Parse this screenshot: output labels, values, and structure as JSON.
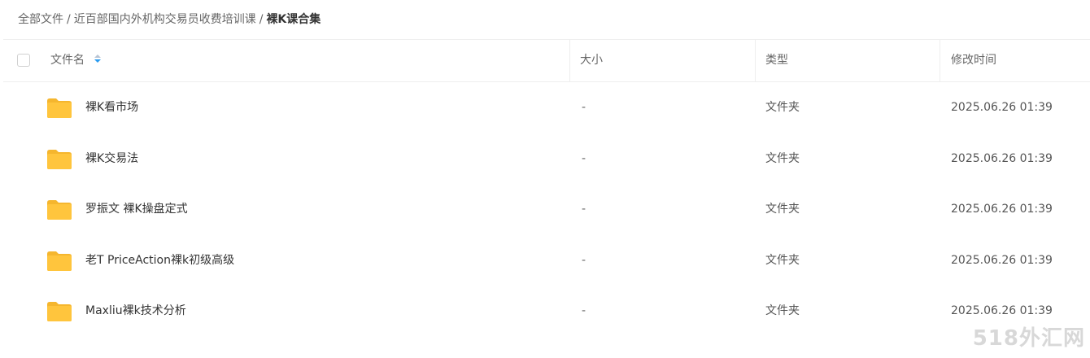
{
  "breadcrumb": {
    "items": [
      "全部文件",
      "近百部国内外机构交易员收费培训课"
    ],
    "separator": "/",
    "current": "裸K课合集"
  },
  "table": {
    "headers": {
      "name": "文件名",
      "size": "大小",
      "type": "类型",
      "mtime": "修改时间"
    },
    "sort": {
      "column": "name",
      "direction": "desc"
    },
    "rows": [
      {
        "icon": "folder-icon",
        "name": "裸K看市场",
        "size": "-",
        "type": "文件夹",
        "mtime": "2025.06.26 01:39"
      },
      {
        "icon": "folder-icon",
        "name": "裸K交易法",
        "size": "-",
        "type": "文件夹",
        "mtime": "2025.06.26 01:39"
      },
      {
        "icon": "folder-icon",
        "name": "罗振文 裸K操盘定式",
        "size": "-",
        "type": "文件夹",
        "mtime": "2025.06.26 01:39"
      },
      {
        "icon": "folder-icon",
        "name": "老T PriceAction裸k初级高级",
        "size": "-",
        "type": "文件夹",
        "mtime": "2025.06.26 01:39"
      },
      {
        "icon": "folder-icon",
        "name": "Maxliu裸k技术分析",
        "size": "-",
        "type": "文件夹",
        "mtime": "2025.06.26 01:39"
      }
    ]
  },
  "watermark": "518外汇网",
  "colors": {
    "folder": "#ffc53d",
    "sort_active": "#2a9bf0",
    "divider": "#eeeeee"
  }
}
